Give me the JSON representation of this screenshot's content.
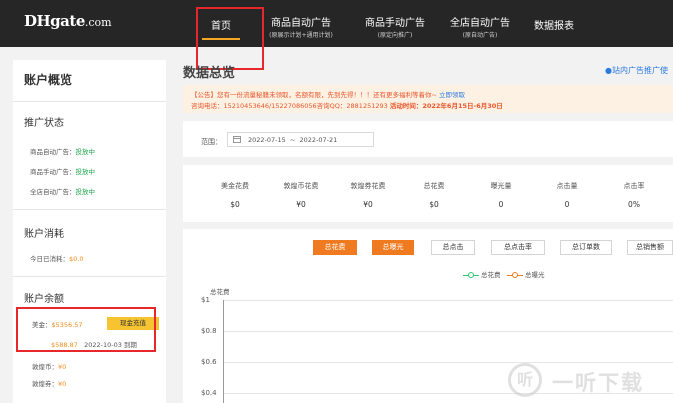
{
  "brand": {
    "logo": "DHgate",
    "logo_suffix": ".com"
  },
  "nav": {
    "items": [
      {
        "label": "首页",
        "sub": ""
      },
      {
        "label": "商品自动广告",
        "sub": "(原展示计划+通用计划)"
      },
      {
        "label": "商品手动广告",
        "sub": "(原定向推广)"
      },
      {
        "label": "全店自动广告",
        "sub": "(原自动广告)"
      },
      {
        "label": "数据报表",
        "sub": ""
      }
    ]
  },
  "sidebar": {
    "title": "账户概览",
    "promo_status": {
      "heading": "推广状态",
      "rows": [
        {
          "label": "商品自动广告：",
          "value": "投放中"
        },
        {
          "label": "商品手动广告：",
          "value": "投放中"
        },
        {
          "label": "全店自动广告：",
          "value": "投放中"
        }
      ]
    },
    "consumption": {
      "heading": "账户消耗",
      "label": "今日已消耗：",
      "value": "$0.0"
    },
    "balance": {
      "heading": "账户余额",
      "cash_label": "美金：",
      "cash_value": "$5356.57",
      "recharge_button": "现金充值",
      "expiring_value": "$588.87",
      "expiring_date": "2022-10-03 到期",
      "coin_label": "敦煌币：",
      "coin_value": "¥0",
      "coupon_label": "敦煌券：",
      "coupon_value": "¥0"
    }
  },
  "main": {
    "title": "数据总览",
    "side_link": "●站内广告推广使",
    "notice": {
      "line1_prefix": "【公告】您有一份流量秘籍未领取，名额有限，先到先得！！！还有更多福利等着你~",
      "line1_link": "立即领取",
      "line2_prefix": "咨询电话：15210453646/15227086056咨询QQ：2881251293",
      "line2_bold": "活动时间：2022年6月15日-6月30日"
    },
    "range": {
      "label": "范围：",
      "start": "2022-07-15",
      "separator": "~",
      "end": "2022-07-21"
    },
    "stats": [
      {
        "label": "美金花费",
        "value": "$0"
      },
      {
        "label": "敦煌币花费",
        "value": "¥0"
      },
      {
        "label": "敦煌券花费",
        "value": "¥0"
      },
      {
        "label": "总花费",
        "value": "$0"
      },
      {
        "label": "曝光量",
        "value": "0"
      },
      {
        "label": "点击量",
        "value": "0"
      },
      {
        "label": "点击率",
        "value": "0%"
      }
    ],
    "metric_buttons": [
      "总花费",
      "总曝光",
      "总点击",
      "总点击率",
      "总订单数",
      "总销售额"
    ],
    "active_metrics": [
      0,
      1
    ]
  },
  "chart_data": {
    "type": "line",
    "title": "",
    "ylabel": "总花费",
    "series": [
      {
        "name": "总花费",
        "color": "#2ecc71",
        "values": []
      },
      {
        "name": "总曝光",
        "color": "#f07a1f",
        "values": []
      }
    ],
    "yticks": [
      "$1",
      "$0.8",
      "$0.6",
      "$0.4"
    ],
    "ylim": [
      0,
      1
    ]
  },
  "watermark": {
    "badge": "听",
    "text": "一听下载"
  },
  "colors": {
    "accent": "#f07a1f",
    "nav_bg": "#262626",
    "highlight": "#e8272b",
    "status": "#1aa64a"
  }
}
